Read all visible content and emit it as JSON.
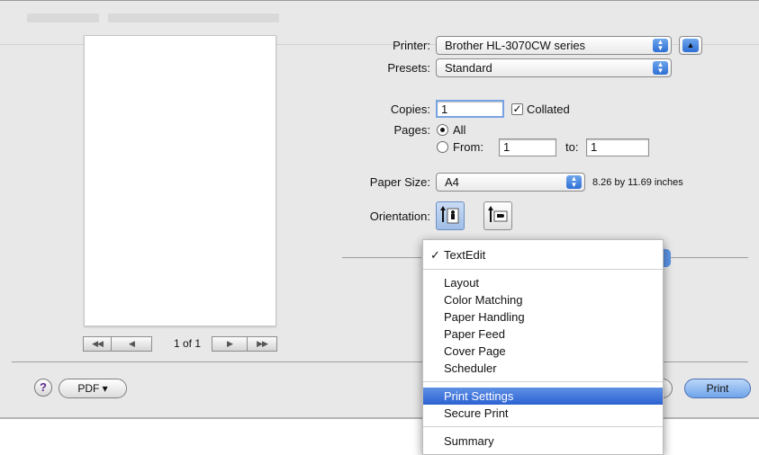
{
  "preview": {
    "page_indicator": "1 of 1",
    "nav": {
      "first": "◀◀",
      "prev": "◀",
      "next": "▶",
      "last": "▶▶"
    }
  },
  "settings": {
    "printer_label": "Printer:",
    "printer_value": "Brother HL-3070CW series",
    "presets_label": "Presets:",
    "presets_value": "Standard",
    "copies_label": "Copies:",
    "copies_value": "1",
    "collated_label": "Collated",
    "collated_checked": true,
    "pages_label": "Pages:",
    "pages_all_label": "All",
    "pages_from_label": "From:",
    "pages_from_value": "1",
    "pages_to_label": "to:",
    "pages_to_value": "1",
    "paper_size_label": "Paper Size:",
    "paper_size_value": "A4",
    "paper_size_dims": "8.26 by 11.69 inches",
    "orientation_label": "Orientation:"
  },
  "bottom_bar": {
    "help_label": "?",
    "pdf_label": "PDF ▾",
    "print_label": "Print"
  },
  "menu": {
    "checked_item": "TextEdit",
    "check_mark": "✓",
    "group1": [
      "Layout",
      "Color Matching",
      "Paper Handling",
      "Paper Feed",
      "Cover Page",
      "Scheduler"
    ],
    "group2": [
      "Print Settings",
      "Secure Print"
    ],
    "group3": [
      "Summary"
    ],
    "highlighted": "Print Settings"
  },
  "colors": {
    "accent": "#3a6fd8",
    "dialog_bg": "#e8e8e8",
    "highlight": "#2c63d2"
  },
  "icons": [
    "stepper-arrows-icon",
    "disclosure-up-icon",
    "portrait-orientation-icon",
    "landscape-orientation-icon",
    "help-icon"
  ]
}
